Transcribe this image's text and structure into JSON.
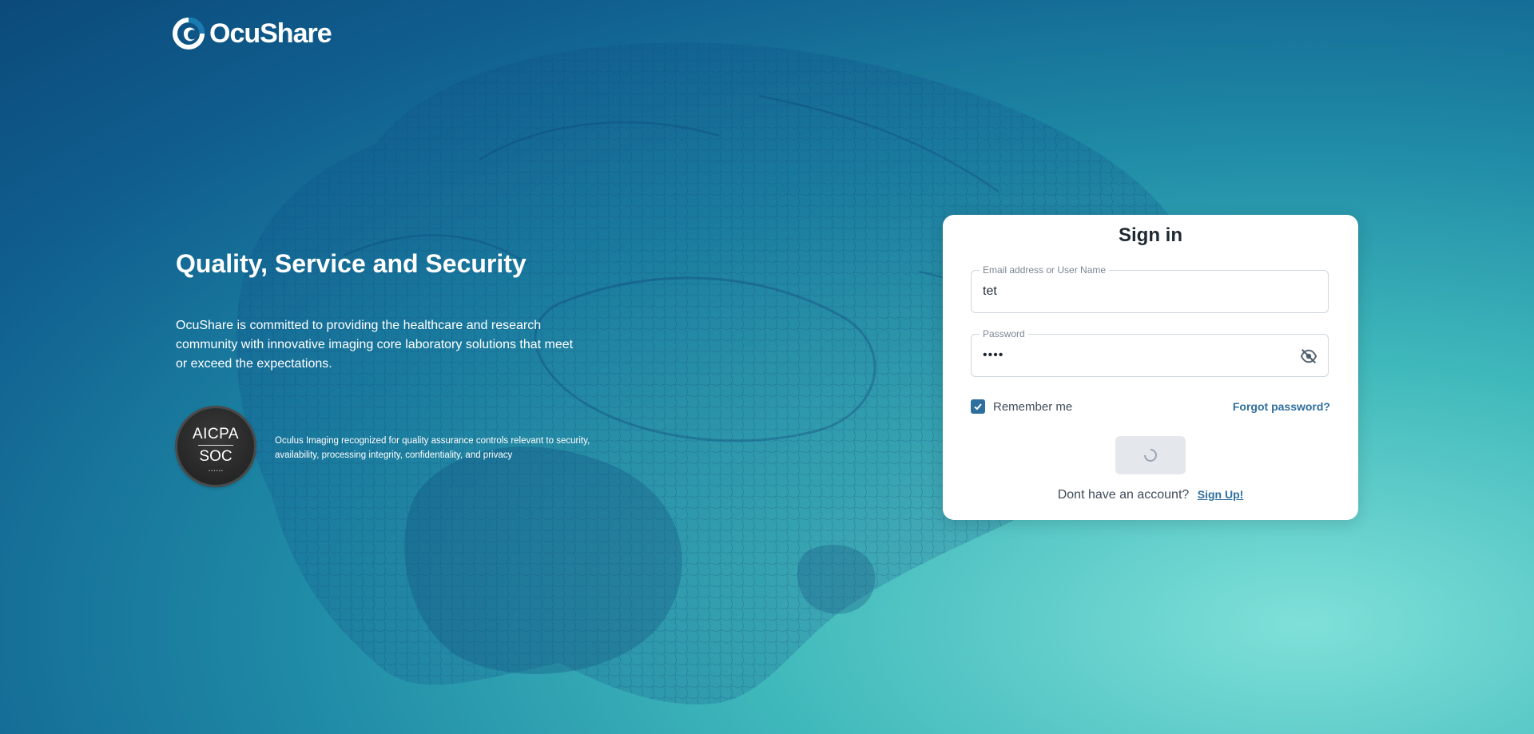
{
  "brand": {
    "name": "OcuShare",
    "logo_icon": "ocushare-logo-icon"
  },
  "hero": {
    "title": "Quality, Service and Security",
    "description": "OcuShare is committed to providing the healthcare and research community with innovative imaging core laboratory solutions that meet or exceed the expectations."
  },
  "badge": {
    "line1": "AICPA",
    "line2": "SOC",
    "caption": "Oculus Imaging recognized for quality assurance controls relevant to security, availability, processing integrity, confidentiality, and privacy"
  },
  "signin": {
    "title": "Sign in",
    "email": {
      "label": "Email address or User Name",
      "value": "tet"
    },
    "password": {
      "label": "Password",
      "value": "••••",
      "toggle_icon": "eye-off-icon"
    },
    "remember": {
      "label": "Remember me",
      "checked": true
    },
    "forgot_label": "Forgot password?",
    "submit_state": "loading",
    "signup_prompt": "Dont have an account?",
    "signup_label": "Sign Up!"
  },
  "colors": {
    "accent": "#2f6f9f",
    "background_dark": "#0b4a7a",
    "background_light": "#7fe0d8"
  }
}
